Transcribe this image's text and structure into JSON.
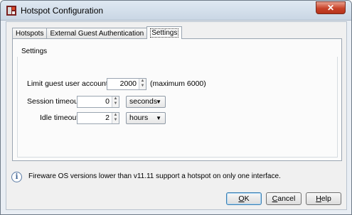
{
  "window": {
    "title": "Hotspot Configuration",
    "close_label": "✕",
    "icon": "app-icon"
  },
  "tabs": [
    {
      "label": "Hotspots",
      "active": false
    },
    {
      "label": "External Guest Authentication",
      "active": false
    },
    {
      "label": "Settings",
      "active": true
    }
  ],
  "settings": {
    "group_title": "Settings",
    "limit_label": "Limit guest user accounts to",
    "limit_value": "2000",
    "limit_hint": "(maximum 6000)",
    "session_label": "Session timeout:",
    "session_value": "0",
    "session_unit": "seconds",
    "idle_label": "Idle timeout:",
    "idle_value": "2",
    "idle_unit": "hours"
  },
  "info": {
    "icon": "info-icon",
    "text": "Fireware OS versions lower than v11.11 support a hotspot on only one interface."
  },
  "buttons": {
    "ok_key": "O",
    "ok_rest": "K",
    "cancel_key": "C",
    "cancel_rest": "ancel",
    "help_key": "H",
    "help_rest": "elp"
  },
  "colors": {
    "titlebar": "#c9d6e4",
    "close": "#c8432a",
    "default_button_border": "#3c7fb1"
  }
}
